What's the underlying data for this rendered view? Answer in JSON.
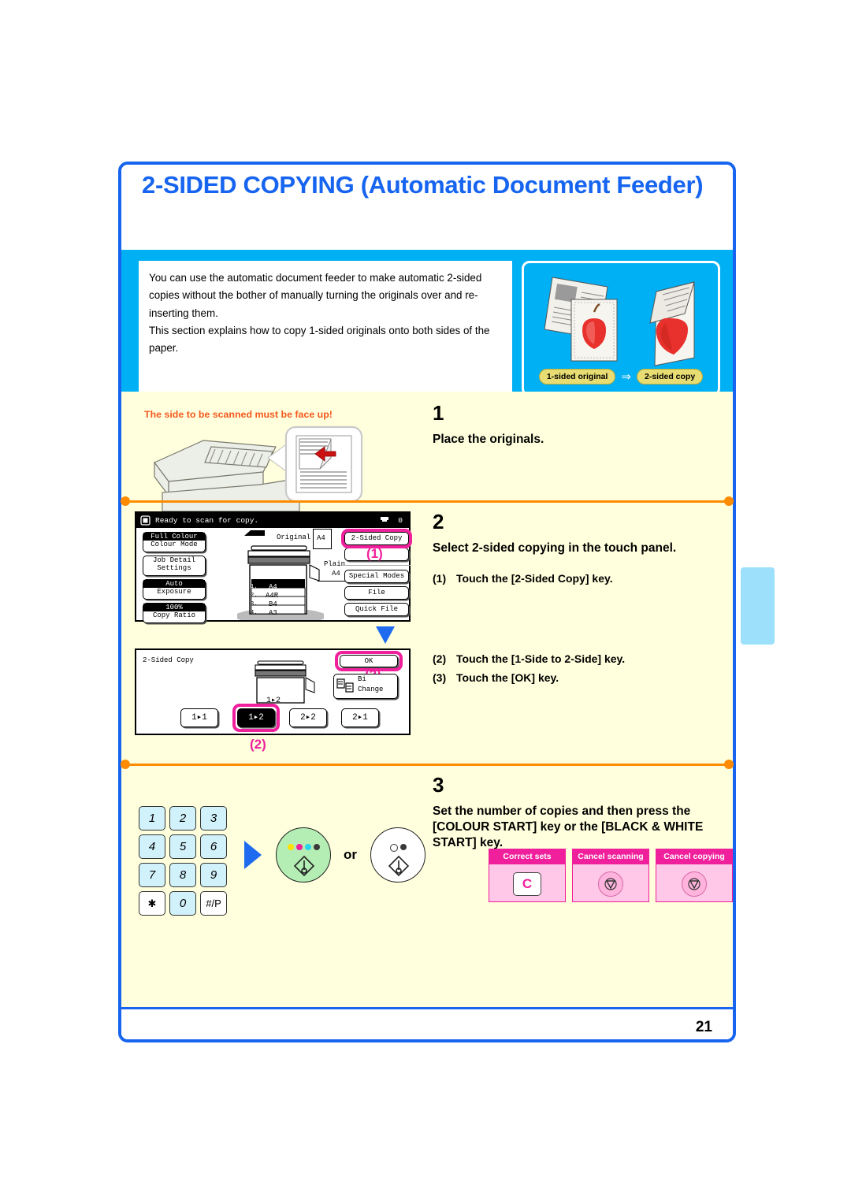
{
  "document": {
    "title": "2-SIDED COPYING (Automatic Document Feeder)",
    "page_number": "21"
  },
  "intro": {
    "paragraph1": "You can use the automatic document feeder to make automatic 2-sided copies without the bother of manually turning the originals over and re-inserting them.",
    "paragraph2": "This section explains how to copy 1-sided originals onto both sides of the paper."
  },
  "illustration": {
    "badge_left": "1-sided original",
    "badge_arrow": "⇒",
    "badge_right": "2-sided copy"
  },
  "steps": [
    {
      "number": "1",
      "heading": "Place the originals.",
      "caption": "The side to be scanned must be face up!"
    },
    {
      "number": "2",
      "heading": "Select 2-sided copying in the touch panel.",
      "substeps": [
        {
          "n": "(1)",
          "text": "Touch the [2-Sided Copy] key."
        },
        {
          "n": "(2)",
          "text": "Touch the [1-Side to 2-Side] key."
        },
        {
          "n": "(3)",
          "text": "Touch the [OK] key."
        }
      ]
    },
    {
      "number": "3",
      "heading": "Set the number of copies and then press the [COLOUR START] key or the [BLACK & WHITE START] key."
    }
  ],
  "touch_panel_1": {
    "status": "Ready to scan for copy.",
    "counter": "0",
    "left_keys": [
      {
        "top": "Full Colour",
        "bottom": "Colour Mode",
        "top_highlighted": true
      },
      {
        "top": "Job Detail",
        "bottom": "Settings",
        "top_highlighted": false
      },
      {
        "top": "Auto",
        "bottom": "Exposure",
        "top_highlighted": true
      },
      {
        "top": "100%",
        "bottom": "Copy Ratio",
        "top_highlighted": true
      }
    ],
    "original_label": "Original",
    "original_size": "A4",
    "paper_type": "Plain",
    "paper_size": "A4",
    "trays": [
      {
        "n": "1.",
        "size": "A4",
        "selected": true
      },
      {
        "n": "2.",
        "size": "A4R",
        "selected": false
      },
      {
        "n": "3.",
        "size": "B4",
        "selected": false
      },
      {
        "n": "4.",
        "size": "A3",
        "selected": false
      }
    ],
    "right_keys": [
      "2-Sided Copy",
      "",
      "Special Modes",
      "File",
      "Quick File"
    ],
    "callout": "(1)"
  },
  "touch_panel_2": {
    "screen_title": "2-Sided Copy",
    "ok_label": "OK",
    "binding_label_line1": "Bi",
    "binding_label_line2": "Change",
    "machine_mode": "1▸2",
    "mode_keys": [
      {
        "label": "1▸1",
        "selected": false
      },
      {
        "label": "1▸2",
        "selected": true
      },
      {
        "label": "2▸2",
        "selected": false
      },
      {
        "label": "2▸1",
        "selected": false
      }
    ],
    "callout_ok": "(3)",
    "callout_mode": "(2)"
  },
  "keypad": {
    "keys": [
      "1",
      "2",
      "3",
      "4",
      "5",
      "6",
      "7",
      "8",
      "9",
      "✱",
      "0",
      "#/P"
    ],
    "or_label": "or",
    "colour_start_dots": [
      "#ffe000",
      "#f01f9b",
      "#2ad4e8",
      "#3a3a3a"
    ],
    "bw_start_dots": [
      "#ffffff",
      "#3a3a3a"
    ]
  },
  "pink_cards": [
    {
      "header": "Correct sets",
      "icon": "C"
    },
    {
      "header": "Cancel scanning",
      "icon": "stop-icon"
    },
    {
      "header": "Cancel copying",
      "icon": "stop-icon"
    }
  ],
  "colors": {
    "brand_blue": "#1664ef",
    "band_cyan": "#00b0f4",
    "step_bg": "#ffffdd",
    "separator_orange": "#ff8c00",
    "highlight_pink": "#f01f9b",
    "caption_orange": "#f4581e",
    "tab_blue": "#9ce0fb"
  }
}
